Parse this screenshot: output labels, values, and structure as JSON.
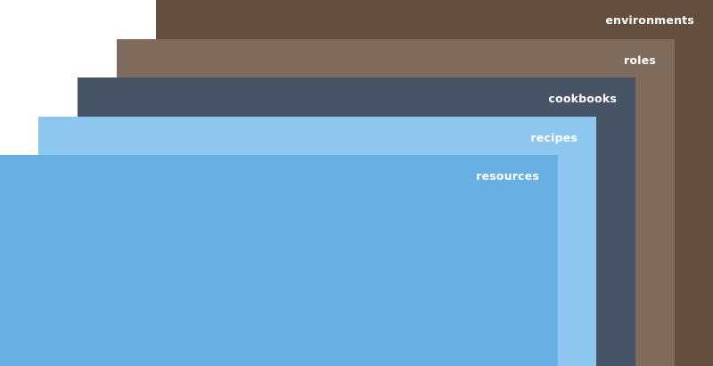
{
  "layers": [
    {
      "id": "environments",
      "label": "environments",
      "color": "#644f3e"
    },
    {
      "id": "roles",
      "label": "roles",
      "color": "#7e6b5c"
    },
    {
      "id": "cookbooks",
      "label": "cookbooks",
      "color": "#475465"
    },
    {
      "id": "recipes",
      "label": "recipes",
      "color": "#8dc6ee"
    },
    {
      "id": "resources",
      "label": "resources",
      "color": "#69b0e2"
    }
  ]
}
